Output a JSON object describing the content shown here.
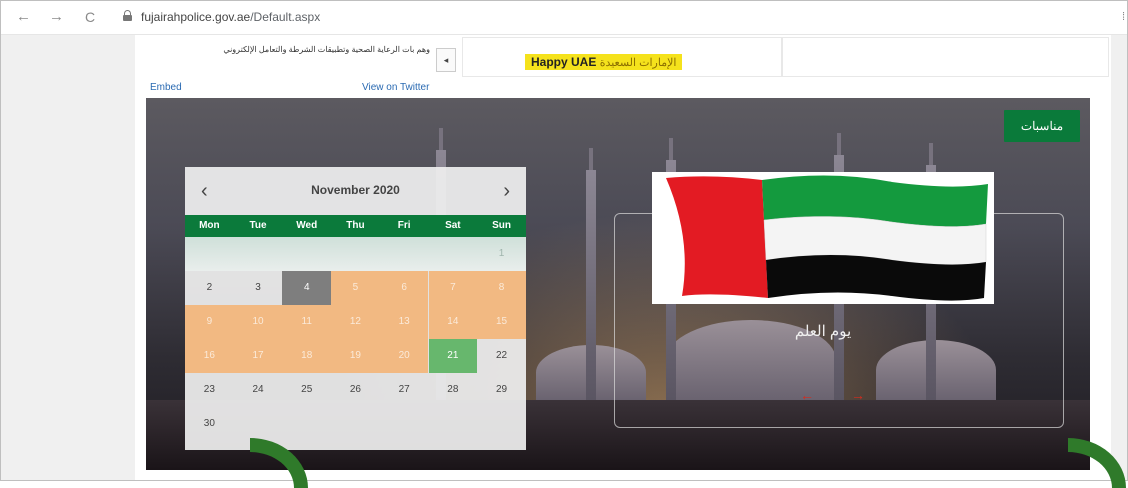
{
  "browser": {
    "back_icon": "←",
    "forward_icon": "→",
    "reload_icon": "C",
    "url_domain": "fujairahpolice.gov.ae",
    "url_path": "/Default.aspx",
    "right_icon": "⁞"
  },
  "header": {
    "ticker_text": "وهم بات الرعاية الصحية وتطبيقات الشرطة والتعامل الإلكتروني",
    "ticker_button": "◂",
    "banner_en": "Happy UAE",
    "banner_ar": "الإمارات السعيدة"
  },
  "twitter": {
    "embed": "Embed",
    "view_on_twitter": "View on Twitter"
  },
  "hero": {
    "occasions_button": "مناسبات",
    "occasion_title": "يوم العلم",
    "prev_arrow": "←",
    "next_arrow": "→"
  },
  "calendar": {
    "prev": "‹",
    "next": "›",
    "month_label": "November 2020",
    "weekdays": [
      "Mon",
      "Tue",
      "Wed",
      "Thu",
      "Fri",
      "Sat",
      "Sun"
    ],
    "weeks": [
      [
        "",
        "",
        "",
        "",
        "",
        "",
        "1"
      ],
      [
        "2",
        "3",
        "4",
        "5",
        "6",
        "7",
        "8"
      ],
      [
        "9",
        "10",
        "11",
        "12",
        "13",
        "14",
        "15"
      ],
      [
        "16",
        "17",
        "18",
        "19",
        "20",
        "21",
        "22"
      ],
      [
        "23",
        "24",
        "25",
        "26",
        "27",
        "28",
        "29"
      ],
      [
        "30",
        "",
        "",
        "",
        "",
        "",
        ""
      ]
    ],
    "today": "4",
    "selected": "21",
    "range_start": "5",
    "range_end": "20"
  },
  "colors": {
    "brand_green": "#0b7a3b",
    "range_orange": "#f2b982",
    "selected_green": "#67b76d",
    "today_gray": "#7e7e7e",
    "flag_red": "#e31b23",
    "flag_green": "#149a3e",
    "flag_black": "#000000"
  }
}
